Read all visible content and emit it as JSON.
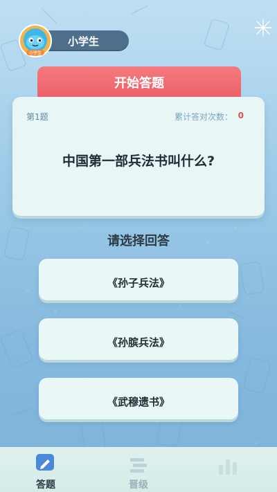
{
  "user": {
    "name": "小学生",
    "avatar_badge": "小学生"
  },
  "banner": {
    "start_label": "开始答题"
  },
  "question": {
    "number_label": "第1题",
    "correct_count_label": "累计答对次数：",
    "correct_count_value": "0",
    "text": "中国第一部兵法书叫什么?"
  },
  "prompt": "请选择回答",
  "options": [
    {
      "label": "《孙子兵法》"
    },
    {
      "label": "《孙膑兵法》"
    },
    {
      "label": "《武穆遗书》"
    }
  ],
  "tabbar": {
    "items": [
      {
        "label": "答题",
        "icon": "pencil-square-icon",
        "active": true
      },
      {
        "label": "晋级",
        "icon": "ranking-icon",
        "active": false
      },
      {
        "label": "",
        "icon": "chart-icon",
        "active": false
      }
    ]
  },
  "colors": {
    "banner": "#ea5d65",
    "card": "#e8f6f6",
    "accent_count": "#e84d55",
    "background_top": "#bfe0f3",
    "background_bottom": "#7cb3da"
  }
}
